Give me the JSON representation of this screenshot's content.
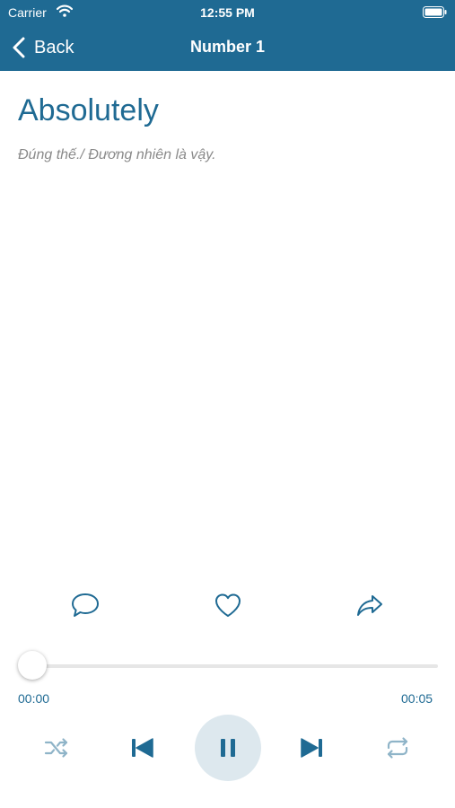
{
  "status_bar": {
    "carrier": "Carrier",
    "time": "12:55 PM"
  },
  "nav": {
    "back_label": "Back",
    "title": "Number 1"
  },
  "content": {
    "word": "Absolutely",
    "translation": "Đúng thế./ Đương nhiên là vậy."
  },
  "actions": {
    "icons": [
      "comment-icon",
      "heart-icon",
      "share-icon"
    ]
  },
  "player": {
    "current_time": "00:00",
    "duration": "00:05",
    "progress": 0.0,
    "controls": [
      "shuffle-icon",
      "previous-icon",
      "pause-icon",
      "next-icon",
      "repeat-icon"
    ]
  },
  "colors": {
    "accent": "#1f6a93",
    "muted_control": "#8fb4c8",
    "play_bg": "#dde8ee"
  }
}
